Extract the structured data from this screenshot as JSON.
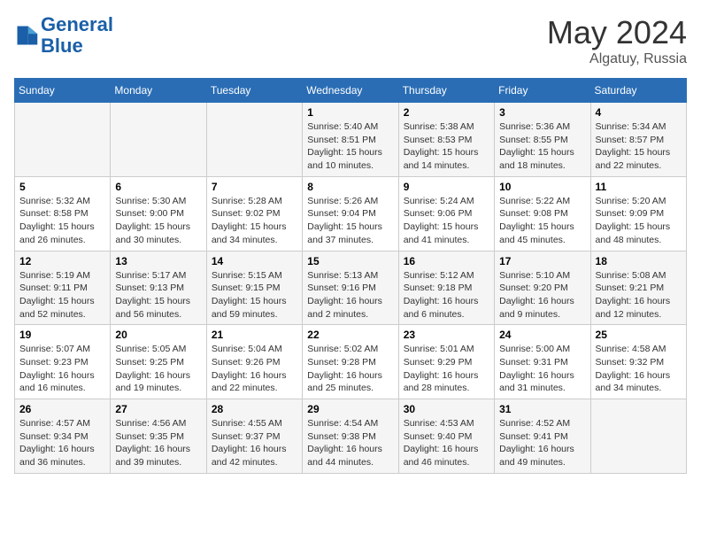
{
  "header": {
    "logo_line1": "General",
    "logo_line2": "Blue",
    "month_year": "May 2024",
    "location": "Algatuy, Russia"
  },
  "days_of_week": [
    "Sunday",
    "Monday",
    "Tuesday",
    "Wednesday",
    "Thursday",
    "Friday",
    "Saturday"
  ],
  "weeks": [
    [
      {
        "day": "",
        "info": ""
      },
      {
        "day": "",
        "info": ""
      },
      {
        "day": "",
        "info": ""
      },
      {
        "day": "1",
        "info": "Sunrise: 5:40 AM\nSunset: 8:51 PM\nDaylight: 15 hours\nand 10 minutes."
      },
      {
        "day": "2",
        "info": "Sunrise: 5:38 AM\nSunset: 8:53 PM\nDaylight: 15 hours\nand 14 minutes."
      },
      {
        "day": "3",
        "info": "Sunrise: 5:36 AM\nSunset: 8:55 PM\nDaylight: 15 hours\nand 18 minutes."
      },
      {
        "day": "4",
        "info": "Sunrise: 5:34 AM\nSunset: 8:57 PM\nDaylight: 15 hours\nand 22 minutes."
      }
    ],
    [
      {
        "day": "5",
        "info": "Sunrise: 5:32 AM\nSunset: 8:58 PM\nDaylight: 15 hours\nand 26 minutes."
      },
      {
        "day": "6",
        "info": "Sunrise: 5:30 AM\nSunset: 9:00 PM\nDaylight: 15 hours\nand 30 minutes."
      },
      {
        "day": "7",
        "info": "Sunrise: 5:28 AM\nSunset: 9:02 PM\nDaylight: 15 hours\nand 34 minutes."
      },
      {
        "day": "8",
        "info": "Sunrise: 5:26 AM\nSunset: 9:04 PM\nDaylight: 15 hours\nand 37 minutes."
      },
      {
        "day": "9",
        "info": "Sunrise: 5:24 AM\nSunset: 9:06 PM\nDaylight: 15 hours\nand 41 minutes."
      },
      {
        "day": "10",
        "info": "Sunrise: 5:22 AM\nSunset: 9:08 PM\nDaylight: 15 hours\nand 45 minutes."
      },
      {
        "day": "11",
        "info": "Sunrise: 5:20 AM\nSunset: 9:09 PM\nDaylight: 15 hours\nand 48 minutes."
      }
    ],
    [
      {
        "day": "12",
        "info": "Sunrise: 5:19 AM\nSunset: 9:11 PM\nDaylight: 15 hours\nand 52 minutes."
      },
      {
        "day": "13",
        "info": "Sunrise: 5:17 AM\nSunset: 9:13 PM\nDaylight: 15 hours\nand 56 minutes."
      },
      {
        "day": "14",
        "info": "Sunrise: 5:15 AM\nSunset: 9:15 PM\nDaylight: 15 hours\nand 59 minutes."
      },
      {
        "day": "15",
        "info": "Sunrise: 5:13 AM\nSunset: 9:16 PM\nDaylight: 16 hours\nand 2 minutes."
      },
      {
        "day": "16",
        "info": "Sunrise: 5:12 AM\nSunset: 9:18 PM\nDaylight: 16 hours\nand 6 minutes."
      },
      {
        "day": "17",
        "info": "Sunrise: 5:10 AM\nSunset: 9:20 PM\nDaylight: 16 hours\nand 9 minutes."
      },
      {
        "day": "18",
        "info": "Sunrise: 5:08 AM\nSunset: 9:21 PM\nDaylight: 16 hours\nand 12 minutes."
      }
    ],
    [
      {
        "day": "19",
        "info": "Sunrise: 5:07 AM\nSunset: 9:23 PM\nDaylight: 16 hours\nand 16 minutes."
      },
      {
        "day": "20",
        "info": "Sunrise: 5:05 AM\nSunset: 9:25 PM\nDaylight: 16 hours\nand 19 minutes."
      },
      {
        "day": "21",
        "info": "Sunrise: 5:04 AM\nSunset: 9:26 PM\nDaylight: 16 hours\nand 22 minutes."
      },
      {
        "day": "22",
        "info": "Sunrise: 5:02 AM\nSunset: 9:28 PM\nDaylight: 16 hours\nand 25 minutes."
      },
      {
        "day": "23",
        "info": "Sunrise: 5:01 AM\nSunset: 9:29 PM\nDaylight: 16 hours\nand 28 minutes."
      },
      {
        "day": "24",
        "info": "Sunrise: 5:00 AM\nSunset: 9:31 PM\nDaylight: 16 hours\nand 31 minutes."
      },
      {
        "day": "25",
        "info": "Sunrise: 4:58 AM\nSunset: 9:32 PM\nDaylight: 16 hours\nand 34 minutes."
      }
    ],
    [
      {
        "day": "26",
        "info": "Sunrise: 4:57 AM\nSunset: 9:34 PM\nDaylight: 16 hours\nand 36 minutes."
      },
      {
        "day": "27",
        "info": "Sunrise: 4:56 AM\nSunset: 9:35 PM\nDaylight: 16 hours\nand 39 minutes."
      },
      {
        "day": "28",
        "info": "Sunrise: 4:55 AM\nSunset: 9:37 PM\nDaylight: 16 hours\nand 42 minutes."
      },
      {
        "day": "29",
        "info": "Sunrise: 4:54 AM\nSunset: 9:38 PM\nDaylight: 16 hours\nand 44 minutes."
      },
      {
        "day": "30",
        "info": "Sunrise: 4:53 AM\nSunset: 9:40 PM\nDaylight: 16 hours\nand 46 minutes."
      },
      {
        "day": "31",
        "info": "Sunrise: 4:52 AM\nSunset: 9:41 PM\nDaylight: 16 hours\nand 49 minutes."
      },
      {
        "day": "",
        "info": ""
      }
    ]
  ]
}
